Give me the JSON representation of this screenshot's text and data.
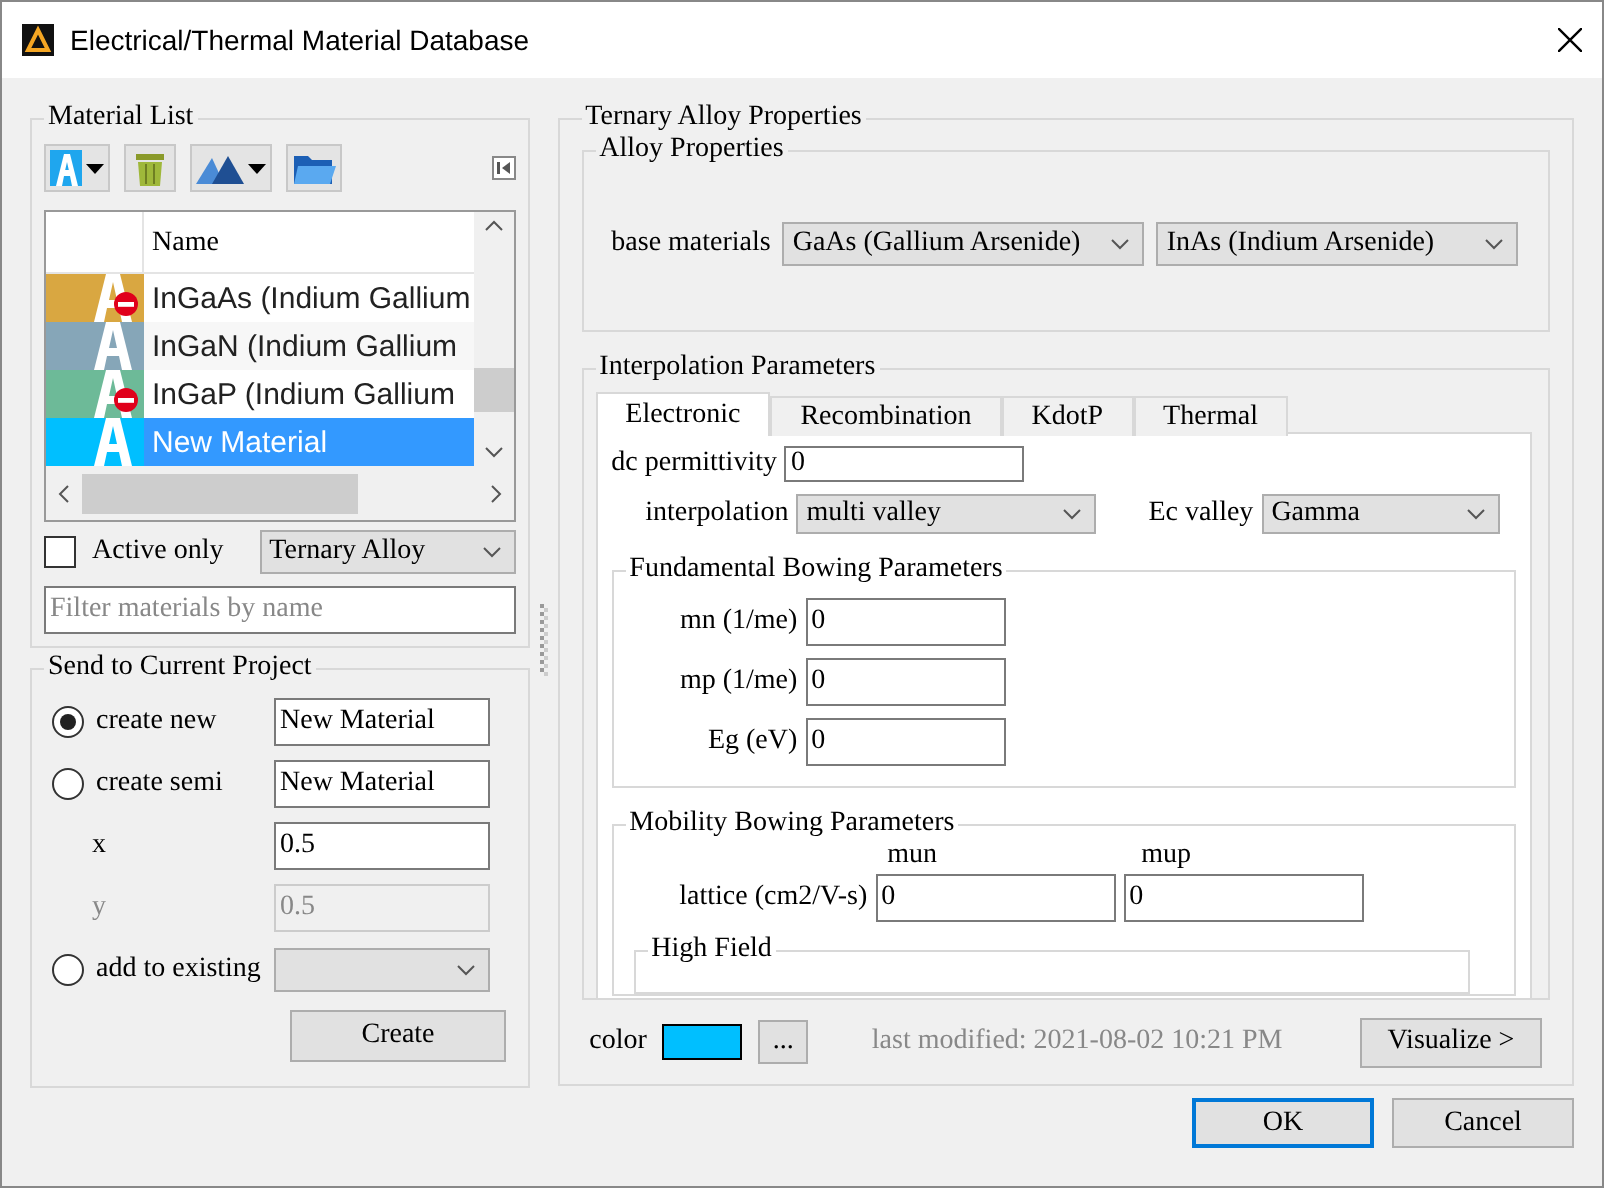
{
  "window": {
    "title": "Electrical/Thermal Material Database"
  },
  "material_list": {
    "title": "Material List",
    "column": "Name",
    "items": [
      {
        "name": "InGaAs (Indium Gallium",
        "color": "#d9a741",
        "inactive": true,
        "selected": false
      },
      {
        "name": "InGaN (Indium Gallium",
        "color": "#86a6b8",
        "inactive": false,
        "selected": false
      },
      {
        "name": "InGaP (Indium Gallium",
        "color": "#6dba98",
        "inactive": true,
        "selected": false
      },
      {
        "name": "New Material",
        "color": "#00bfff",
        "inactive": false,
        "selected": true
      }
    ],
    "active_only": {
      "label": "Active only",
      "checked": false
    },
    "type_filter": "Ternary Alloy",
    "filter": {
      "placeholder": "Filter materials by name"
    }
  },
  "send": {
    "title": "Send to Current Project",
    "rows": [
      {
        "kind": "radio-text",
        "label": "create new",
        "selected": true,
        "value": "New Material"
      },
      {
        "kind": "radio-text",
        "label": "create semi",
        "selected": false,
        "value": "New Material"
      },
      {
        "kind": "field",
        "label": "x",
        "value": "0.5",
        "disabled": false
      },
      {
        "kind": "field",
        "label": "y",
        "value": "0.5",
        "disabled": true
      },
      {
        "kind": "radio-select",
        "label": "add to existing",
        "selected": false
      }
    ],
    "create": "Create"
  },
  "alloy": {
    "title": "Ternary Alloy Properties",
    "alloy_properties": {
      "title": "Alloy Properties",
      "label": "base materials",
      "materials": [
        "GaAs (Gallium Arsenide)",
        "InAs (Indium Arsenide)"
      ]
    },
    "interpolation": {
      "title": "Interpolation Parameters",
      "tabs": [
        {
          "label": "Electronic",
          "selected": true
        },
        {
          "label": "Recombination",
          "selected": false
        },
        {
          "label": "KdotP",
          "selected": false
        },
        {
          "label": "Thermal",
          "selected": false
        }
      ],
      "dc_permittivity": {
        "label": "dc permittivity",
        "value": "0"
      },
      "interpolation": {
        "label": "interpolation",
        "value": "multi valley"
      },
      "ec_valley": {
        "label": "Ec valley",
        "value": "Gamma"
      },
      "fundamental": {
        "title": "Fundamental Bowing Parameters",
        "fields": [
          {
            "label": "mn (1/me)",
            "value": "0"
          },
          {
            "label": "mp (1/me)",
            "value": "0"
          },
          {
            "label": "Eg (eV)",
            "value": "0"
          }
        ]
      },
      "mobility": {
        "title": "Mobility Bowing Parameters",
        "columns": [
          "mun",
          "mup"
        ],
        "label": "lattice (cm2/V-s)",
        "values": [
          "0",
          "0"
        ]
      },
      "high_field": {
        "title": "High Field"
      }
    },
    "color": {
      "label": "color",
      "color": "#00bfff"
    },
    "more": "...",
    "last_modified": "last modified: 2021-08-02 10:21 PM",
    "visualize": "Visualize >"
  },
  "buttons": [
    {
      "label": "OK",
      "default": true
    },
    {
      "label": "Cancel",
      "default": false
    }
  ]
}
